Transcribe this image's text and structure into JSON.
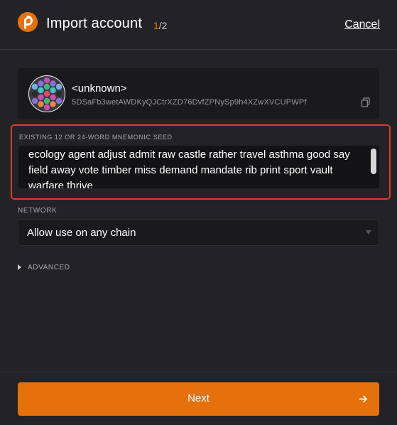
{
  "header": {
    "title": "Import account",
    "step_current": "1",
    "step_total": "/2",
    "cancel_label": "Cancel",
    "logo_icon": "polkadot-logo-icon"
  },
  "account": {
    "name": "<unknown>",
    "address": "5DSaFb3wetAWDKyQJCtrXZD76DvfZPNySp9h4XZwXVCUPWPf",
    "copy_icon": "copy-icon"
  },
  "seed": {
    "label": "EXISTING 12 OR 24-WORD MNEMONIC SEED",
    "value": "ecology agent adjust admit raw castle rather travel asthma good say field away vote timber miss demand mandate rib print sport vault warfare thrive"
  },
  "network": {
    "label": "NETWORK",
    "selected": "Allow use on any chain"
  },
  "advanced": {
    "label": "ADVANCED"
  },
  "footer": {
    "next_label": "Next"
  },
  "colors": {
    "accent": "#e6710a",
    "background": "#232327",
    "error_border": "#dd3a2a"
  }
}
